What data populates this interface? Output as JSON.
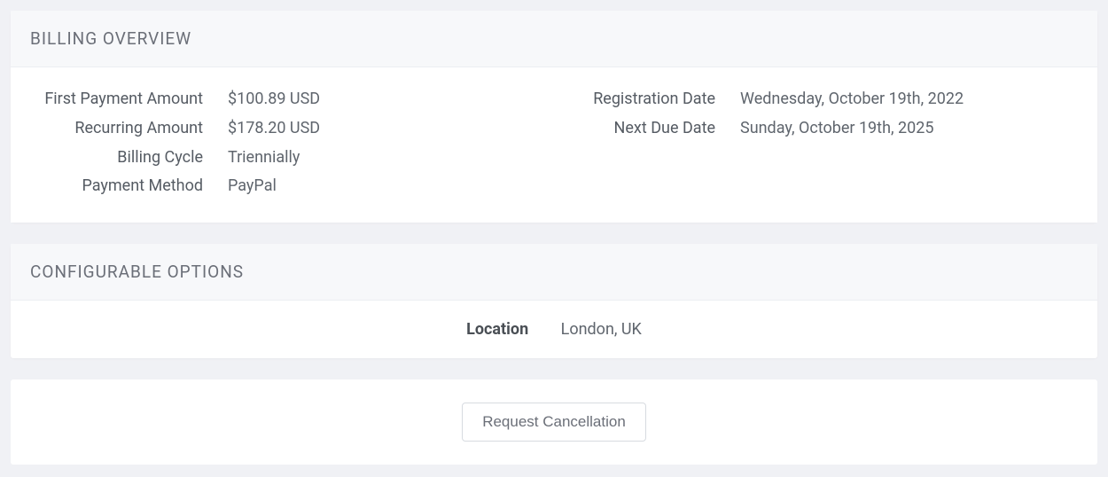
{
  "billing": {
    "title": "BILLING OVERVIEW",
    "left": {
      "first_payment_label": "First Payment Amount",
      "first_payment_value": "$100.89 USD",
      "recurring_label": "Recurring Amount",
      "recurring_value": "$178.20 USD",
      "cycle_label": "Billing Cycle",
      "cycle_value": "Triennially",
      "method_label": "Payment Method",
      "method_value": "PayPal"
    },
    "right": {
      "reg_date_label": "Registration Date",
      "reg_date_value": "Wednesday, October 19th, 2022",
      "due_date_label": "Next Due Date",
      "due_date_value": "Sunday, October 19th, 2025"
    }
  },
  "config": {
    "title": "CONFIGURABLE OPTIONS",
    "location_label": "Location",
    "location_value": "London, UK"
  },
  "actions": {
    "request_cancellation": "Request Cancellation"
  }
}
